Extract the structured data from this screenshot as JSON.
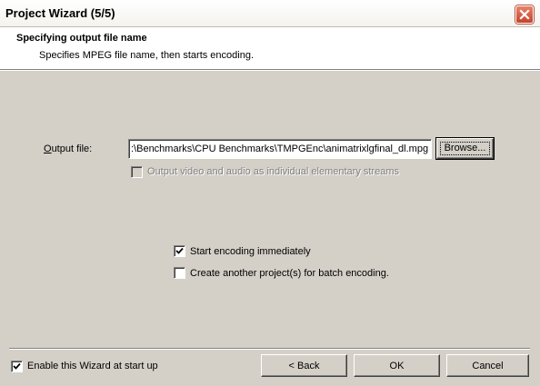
{
  "window": {
    "title": "Project Wizard (5/5)"
  },
  "header": {
    "title": "Specifying output file name",
    "subtitle": "Specifies MPEG file name, then starts encoding."
  },
  "output": {
    "label": "Output file:",
    "value": ":\\Benchmarks\\CPU Benchmarks\\TMPGEnc\\animatrixlgfinal_dl.mpg",
    "browse_label": "Browse..."
  },
  "options": {
    "elementary_streams": {
      "label": "Output video and audio as individual elementary streams",
      "checked": false,
      "enabled": false
    },
    "start_encoding": {
      "label": "Start encoding immediately",
      "checked": true
    },
    "batch_encoding": {
      "label": "Create another project(s) for batch encoding.",
      "checked": false
    }
  },
  "footer": {
    "enable_wizard": {
      "label": "Enable this Wizard at start up",
      "checked": true
    },
    "back_label": "< Back",
    "ok_label": "OK",
    "cancel_label": "Cancel"
  }
}
